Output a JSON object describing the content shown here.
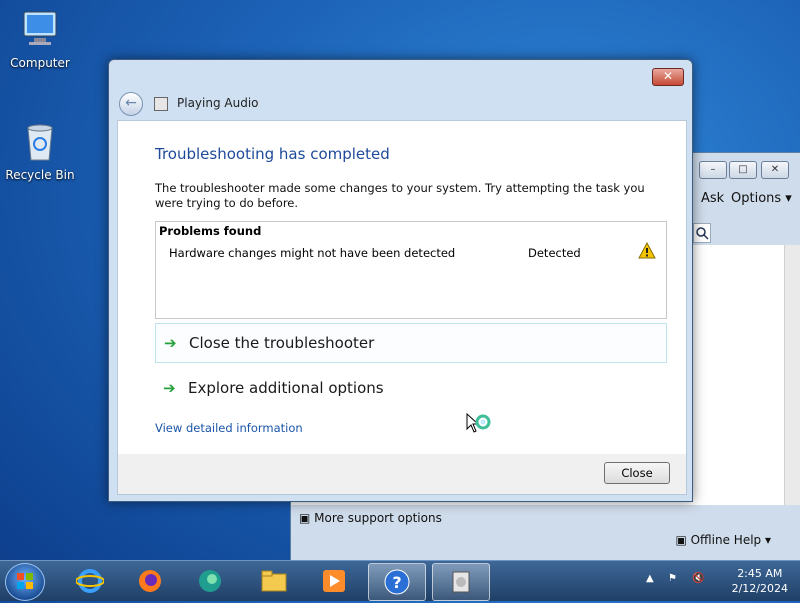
{
  "desktop": {
    "icons": [
      {
        "label": "Computer"
      },
      {
        "label": "Recycle Bin"
      }
    ]
  },
  "help_window": {
    "minimize_label": "–",
    "maximize_label": "□",
    "close_label": "✕",
    "menu_ask": "Ask",
    "menu_options": "Options",
    "support_link": "More support options",
    "offline_help": "Offline Help"
  },
  "dialog": {
    "window_title": "Playing Audio",
    "close_x": "✕",
    "heading": "Troubleshooting has completed",
    "description": "The troubleshooter made some changes to your system. Try attempting the task you were trying to do before.",
    "problems_header": "Problems found",
    "problems": [
      {
        "text": "Hardware changes might not have been detected",
        "status": "Detected",
        "icon": "warning-icon"
      }
    ],
    "commands": {
      "close": "Close the troubleshooter",
      "explore": "Explore additional options"
    },
    "details_link": "View detailed information",
    "close_button": "Close"
  },
  "taskbar": {
    "apps": [
      "start",
      "internet-explorer",
      "firefox",
      "edge",
      "file-explorer",
      "media-player",
      "help-and-support",
      "troubleshooter"
    ],
    "time": "2:45 AM",
    "date": "2/12/2024"
  },
  "colors": {
    "heading": "#1e4a9a",
    "link": "#1a55a8",
    "arrow": "#25a03a",
    "warning": "#f5c400"
  }
}
